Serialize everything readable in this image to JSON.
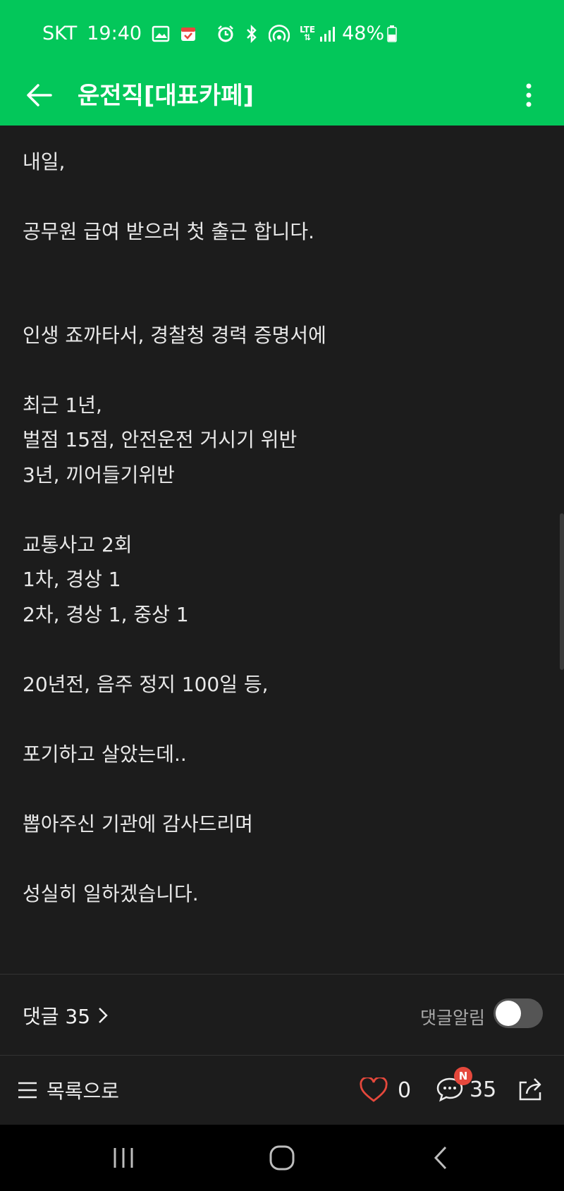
{
  "status_bar": {
    "carrier": "SKT",
    "time": "19:40",
    "network": "LTE",
    "battery": "48%",
    "icons": [
      "gallery-icon",
      "calendar-icon",
      "alarm-icon",
      "bluetooth-icon",
      "hotspot-icon",
      "signal-icon",
      "battery-icon"
    ]
  },
  "app_bar": {
    "title": "운전직[대표카페]",
    "accent": "#03c75a"
  },
  "post": {
    "lines": [
      "내일,",
      "공무원 급여 받으러 첫 출근 합니다.",
      "인생 죠까타서, 경찰청 경력 증명서에",
      "최근 1년,",
      "벌점 15점, 안전운전 거시기 위반",
      "3년, 끼어들기위반",
      "교통사고 2회",
      "1차, 경상 1",
      "2차, 경상 1, 중상 1",
      "20년전, 음주 정지 100일  등,",
      "포기하고 살았는데..",
      "뽑아주신 기관에 감사드리며",
      "성실히 일하겠습니다."
    ]
  },
  "comments": {
    "label": "댓글 35",
    "alarm_label": "댓글알림",
    "alarm_on": false
  },
  "bottom_bar": {
    "list_label": "목록으로",
    "like_count": "0",
    "comment_count": "35",
    "new_badge": "N"
  }
}
